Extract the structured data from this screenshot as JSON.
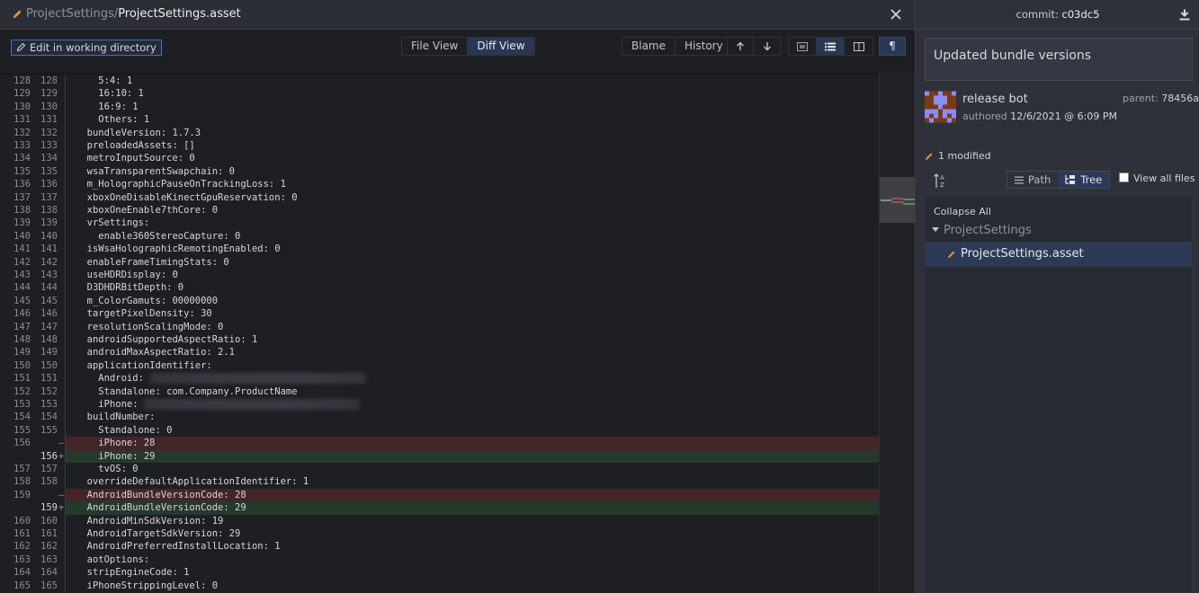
{
  "header": {
    "path_prefix": "ProjectSettings/",
    "file_name": "ProjectSettings.asset",
    "edit_icon": "pencil-icon",
    "close_icon": "close-icon"
  },
  "toolbar": {
    "edit_in_working_directory": "Edit in working directory",
    "view_tabs": [
      {
        "label": "File View",
        "active": false
      },
      {
        "label": "Diff View",
        "active": true
      }
    ],
    "blame_label": "Blame",
    "history_label": "History",
    "prev_change_icon": "arrow-up-icon",
    "next_change_icon": "arrow-down-icon",
    "mode_icons": [
      {
        "icon": "hunk-view-icon",
        "active": false
      },
      {
        "icon": "inline-list-view-icon",
        "active": true
      },
      {
        "icon": "split-view-icon",
        "active": false
      }
    ],
    "whitespace_toggle": "¶"
  },
  "diff": {
    "lines": [
      {
        "old": "128",
        "new": "128",
        "type": "ctx",
        "text": "    5:4: 1"
      },
      {
        "old": "129",
        "new": "129",
        "type": "ctx",
        "text": "    16:10: 1"
      },
      {
        "old": "130",
        "new": "130",
        "type": "ctx",
        "text": "    16:9: 1"
      },
      {
        "old": "131",
        "new": "131",
        "type": "ctx",
        "text": "    Others: 1"
      },
      {
        "old": "132",
        "new": "132",
        "type": "ctx",
        "text": "  bundleVersion: 1.7.3"
      },
      {
        "old": "133",
        "new": "133",
        "type": "ctx",
        "text": "  preloadedAssets: []"
      },
      {
        "old": "134",
        "new": "134",
        "type": "ctx",
        "text": "  metroInputSource: 0"
      },
      {
        "old": "135",
        "new": "135",
        "type": "ctx",
        "text": "  wsaTransparentSwapchain: 0"
      },
      {
        "old": "136",
        "new": "136",
        "type": "ctx",
        "text": "  m_HolographicPauseOnTrackingLoss: 1"
      },
      {
        "old": "137",
        "new": "137",
        "type": "ctx",
        "text": "  xboxOneDisableKinectGpuReservation: 0"
      },
      {
        "old": "138",
        "new": "138",
        "type": "ctx",
        "text": "  xboxOneEnable7thCore: 0"
      },
      {
        "old": "139",
        "new": "139",
        "type": "ctx",
        "text": "  vrSettings:"
      },
      {
        "old": "140",
        "new": "140",
        "type": "ctx",
        "text": "    enable360StereoCapture: 0"
      },
      {
        "old": "141",
        "new": "141",
        "type": "ctx",
        "text": "  isWsaHolographicRemotingEnabled: 0"
      },
      {
        "old": "142",
        "new": "142",
        "type": "ctx",
        "text": "  enableFrameTimingStats: 0"
      },
      {
        "old": "143",
        "new": "143",
        "type": "ctx",
        "text": "  useHDRDisplay: 0"
      },
      {
        "old": "144",
        "new": "144",
        "type": "ctx",
        "text": "  D3DHDRBitDepth: 0"
      },
      {
        "old": "145",
        "new": "145",
        "type": "ctx",
        "text": "  m_ColorGamuts: 00000000"
      },
      {
        "old": "146",
        "new": "146",
        "type": "ctx",
        "text": "  targetPixelDensity: 30"
      },
      {
        "old": "147",
        "new": "147",
        "type": "ctx",
        "text": "  resolutionScalingMode: 0"
      },
      {
        "old": "148",
        "new": "148",
        "type": "ctx",
        "text": "  androidSupportedAspectRatio: 1"
      },
      {
        "old": "149",
        "new": "149",
        "type": "ctx",
        "text": "  androidMaxAspectRatio: 2.1"
      },
      {
        "old": "150",
        "new": "150",
        "type": "ctx",
        "text": "  applicationIdentifier:"
      },
      {
        "old": "151",
        "new": "151",
        "type": "ctx",
        "text": "    Android: ",
        "redacted": true
      },
      {
        "old": "152",
        "new": "152",
        "type": "ctx",
        "text": "    Standalone: com.Company.ProductName"
      },
      {
        "old": "153",
        "new": "153",
        "type": "ctx",
        "text": "    iPhone: ",
        "redacted": true
      },
      {
        "old": "154",
        "new": "154",
        "type": "ctx",
        "text": "  buildNumber:"
      },
      {
        "old": "155",
        "new": "155",
        "type": "ctx",
        "text": "    Standalone: 0"
      },
      {
        "old": "156",
        "new": "",
        "type": "del",
        "text": "    iPhone: 28"
      },
      {
        "old": "",
        "new": "156",
        "type": "add",
        "text": "    iPhone: 29"
      },
      {
        "old": "157",
        "new": "157",
        "type": "ctx",
        "text": "    tvOS: 0"
      },
      {
        "old": "158",
        "new": "158",
        "type": "ctx",
        "text": "  overrideDefaultApplicationIdentifier: 1"
      },
      {
        "old": "159",
        "new": "",
        "type": "del",
        "text": "  AndroidBundleVersionCode: 28"
      },
      {
        "old": "",
        "new": "159",
        "type": "add",
        "text": "  AndroidBundleVersionCode: 29"
      },
      {
        "old": "160",
        "new": "160",
        "type": "ctx",
        "text": "  AndroidMinSdkVersion: 19"
      },
      {
        "old": "161",
        "new": "161",
        "type": "ctx",
        "text": "  AndroidTargetSdkVersion: 29"
      },
      {
        "old": "162",
        "new": "162",
        "type": "ctx",
        "text": "  AndroidPreferredInstallLocation: 1"
      },
      {
        "old": "163",
        "new": "163",
        "type": "ctx",
        "text": "  aotOptions:"
      },
      {
        "old": "164",
        "new": "164",
        "type": "ctx",
        "text": "  stripEngineCode: 1"
      },
      {
        "old": "165",
        "new": "165",
        "type": "ctx",
        "text": "  iPhoneStrippingLevel: 0"
      }
    ],
    "colors": {
      "deleted_bg": "#442629",
      "added_bg": "#26392d"
    }
  },
  "commit": {
    "label": "commit: ",
    "hash": "c03dc5",
    "download_icon": "download-icon",
    "message": "Updated bundle versions",
    "author": "release bot",
    "authored_label": "authored ",
    "date": "12/6/2021 @ 6:09 PM",
    "parent_label": "parent: ",
    "parent_hash": "78456a",
    "avatar_colors": {
      "bg": "#7a3b12",
      "fg": "#8a8cf5"
    }
  },
  "files": {
    "summary": "1 modified",
    "sort_icon": "sort-az-icon",
    "view_modes": [
      {
        "label": "Path",
        "icon": "list-icon",
        "active": false
      },
      {
        "label": "Tree",
        "icon": "tree-icon",
        "active": true
      }
    ],
    "view_all_files_label": "View all files",
    "view_all_files_checked": false,
    "collapse_all_label": "Collapse All",
    "tree": [
      {
        "folder": "ProjectSettings",
        "expanded": true,
        "files": [
          {
            "name": "ProjectSettings.asset",
            "status": "modified",
            "selected": true
          }
        ]
      }
    ]
  },
  "accent": {
    "modified_icon": "#e0913a",
    "selection": "#2c3a56",
    "active_toggle": "#283754",
    "focus_border": "#3b6fd1"
  }
}
